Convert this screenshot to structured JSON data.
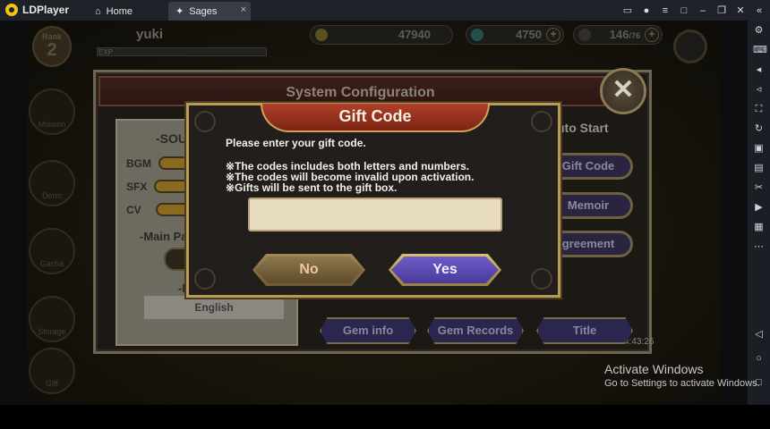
{
  "titlebar": {
    "app_name": "LDPlayer",
    "tabs": [
      {
        "label": "Home"
      },
      {
        "label": "Sages",
        "close": "×"
      }
    ]
  },
  "hud": {
    "rank_label": "Rank",
    "rank_value": "2",
    "player_name": "yuki",
    "exp_label": "EXP",
    "gold": "47940",
    "gems": "4750",
    "stamina": "146",
    "stamina_max": "/76"
  },
  "side_menu": [
    "Mission",
    "Dorm",
    "Gacha",
    "Storage",
    "Gift"
  ],
  "system_config": {
    "title": "System Configuration",
    "close_glyph": "✕",
    "sound_title": "-SOU",
    "sliders": [
      "BGM",
      "SFX",
      "CV"
    ],
    "main_panel_label": "-Main Pa",
    "language_label": "-L",
    "language_value": "English",
    "auto_start_label": "uto Start",
    "right_buttons": [
      "Gift Code",
      "Memoir",
      "greement"
    ],
    "bottom_buttons": [
      "Gem info",
      "Gem Records",
      "Title"
    ],
    "info_time": "4:43:26"
  },
  "gift_dialog": {
    "title": "Gift Code",
    "prompt": "Please enter your gift code.",
    "notes": [
      "※The codes includes both letters and numbers.",
      "※The codes will become invalid upon activation.",
      "※Gifts will be sent to the gift box."
    ],
    "input_value": "",
    "no_label": "No",
    "yes_label": "Yes"
  },
  "watermark": {
    "title": "Activate Windows",
    "subtitle": "Go to Settings to activate Windows."
  },
  "colors": {
    "dialog_border": "#b79a55",
    "yes_button": "#5a48b0",
    "no_button": "#7a6440",
    "banner_red": "#a0381f"
  }
}
